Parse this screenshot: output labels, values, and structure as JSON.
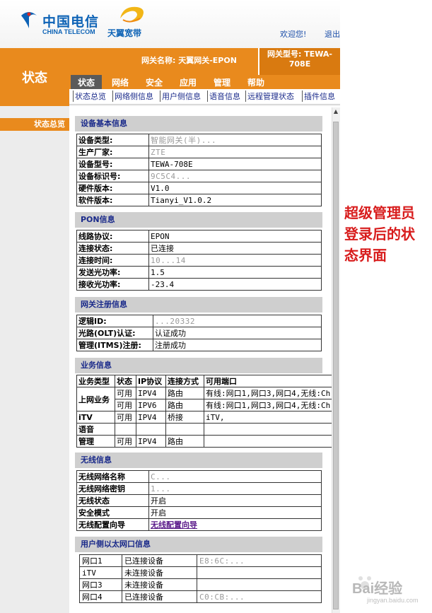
{
  "header": {
    "brand_cn": "中国电信",
    "brand_en": "CHINA TELECOM",
    "tianyi": "天翼宽带",
    "welcome": "欢迎您!",
    "logout": "退出",
    "gateway_name": "网关名称:  天翼网关-EPON",
    "gateway_model_line1": "网关型号: TEWA-",
    "gateway_model_line2": "708E",
    "page_title": "状态"
  },
  "nav": {
    "tabs": [
      "状态",
      "网络",
      "安全",
      "应用",
      "管理",
      "帮助"
    ],
    "active": 0
  },
  "subnav": [
    "状态总览",
    "网络侧信息",
    "用户侧信息",
    "语音信息",
    "远程管理状态",
    "插件信息"
  ],
  "sidebar": {
    "item": "状态总览"
  },
  "device_info": {
    "title": "设备基本信息",
    "rows": [
      {
        "key": "设备类型:",
        "value": "智能网关(半)..."
      },
      {
        "key": "生产厂家:",
        "value": "ZTE"
      },
      {
        "key": "设备型号:",
        "value": "TEWA-708E"
      },
      {
        "key": "设备标识号:",
        "value": "9C5C4..."
      },
      {
        "key": "硬件版本:",
        "value": "V1.0"
      },
      {
        "key": "软件版本:",
        "value": "Tianyi_V1.0.2"
      }
    ]
  },
  "pon_info": {
    "title": "PON信息",
    "rows": [
      {
        "key": "线路协议:",
        "value": "EPON"
      },
      {
        "key": "连接状态:",
        "value": "已连接"
      },
      {
        "key": "连接时间:",
        "value": "10...14"
      },
      {
        "key": "发送光功率:",
        "value": "1.5"
      },
      {
        "key": "接收光功率:",
        "value": "-23.4"
      }
    ]
  },
  "gw_register": {
    "title": "网关注册信息",
    "rows": [
      {
        "key": "逻辑ID:",
        "value": "...20332"
      },
      {
        "key": "光路(OLT)认证:",
        "value": "认证成功"
      },
      {
        "key": "管理(ITMS)注册:",
        "value": "注册成功"
      }
    ]
  },
  "service_info": {
    "title": "业务信息",
    "headers": [
      "业务类型",
      "状态",
      "IP协议",
      "连接方式",
      "可用端口"
    ],
    "internet_label": "上网业务",
    "rows": [
      {
        "status": "可用",
        "ip": "IPV4",
        "mode": "路由",
        "ports": "有线:网口1,网口3,网口4,无线:Ch"
      },
      {
        "status": "可用",
        "ip": "IPV6",
        "mode": "路由",
        "ports": "有线:网口1,网口3,网口4,无线:Ch"
      }
    ],
    "itv": {
      "type": "iTV",
      "status": "可用",
      "ip": "IPV4",
      "mode": "桥接",
      "ports": "iTV,"
    },
    "voice": {
      "type": "语音",
      "status": "",
      "ip": "",
      "mode": "",
      "ports": ""
    },
    "manage": {
      "type": "管理",
      "status": "可用",
      "ip": "IPV4",
      "mode": "路由",
      "ports": ""
    }
  },
  "wireless_info": {
    "title": "无线信息",
    "rows": [
      {
        "key": "无线网络名称",
        "value": "C..."
      },
      {
        "key": "无线网络密钥",
        "value": "1..."
      },
      {
        "key": "无线状态",
        "value": "开启"
      },
      {
        "key": "安全模式",
        "value": "开启"
      }
    ],
    "wizard_key": "无线配置向导",
    "wizard_link": "无线配置向导"
  },
  "eth_info": {
    "title": "用户侧以太网口信息",
    "rows": [
      {
        "port": "网口1",
        "status": "已连接设备",
        "mac": "E8:6C:..."
      },
      {
        "port": "iTV",
        "status": "未连接设备",
        "mac": ""
      },
      {
        "port": "网口3",
        "status": "未连接设备",
        "mac": ""
      },
      {
        "port": "网口4",
        "status": "已连接设备",
        "mac": "C0:CB:..."
      }
    ]
  },
  "annotation": {
    "line1": "超级管理员",
    "line2": "登录后的状",
    "line3": "态界面"
  },
  "watermark": {
    "text": "Bai经验",
    "sub": "jingyan.baidu.com"
  },
  "colors": {
    "orange": "#e98a1d",
    "nav_active": "#5a5a5a",
    "section_bg": "#cfcfcf",
    "annotation": "#d81c1c"
  }
}
